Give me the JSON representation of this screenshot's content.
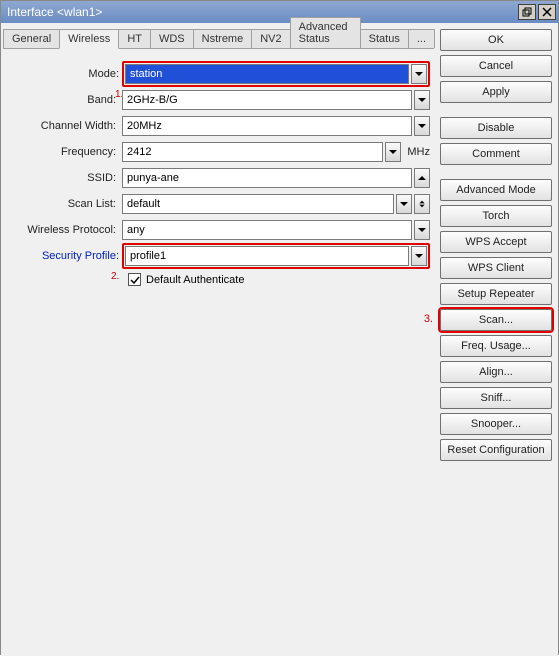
{
  "window": {
    "title": "Interface <wlan1>"
  },
  "tabs": {
    "general": "General",
    "wireless": "Wireless",
    "ht": "HT",
    "wds": "WDS",
    "nstreme": "Nstreme",
    "nv2": "NV2",
    "advanced_status": "Advanced Status",
    "status": "Status",
    "more": "..."
  },
  "form": {
    "mode_label": "Mode:",
    "mode_value": "station",
    "band_label": "Band:",
    "band_value": "2GHz-B/G",
    "chwidth_label": "Channel Width:",
    "chwidth_value": "20MHz",
    "freq_label": "Frequency:",
    "freq_value": "2412",
    "freq_unit": "MHz",
    "ssid_label": "SSID:",
    "ssid_value": "punya-ane",
    "scanlist_label": "Scan List:",
    "scanlist_value": "default",
    "wproto_label": "Wireless Protocol:",
    "wproto_value": "any",
    "secprof_label": "Security Profile:",
    "secprof_value": "profile1",
    "default_auth_label": "Default Authenticate"
  },
  "annotations": {
    "one": "1.",
    "two": "2.",
    "three": "3."
  },
  "buttons": {
    "ok": "OK",
    "cancel": "Cancel",
    "apply": "Apply",
    "disable": "Disable",
    "comment": "Comment",
    "advanced_mode": "Advanced Mode",
    "torch": "Torch",
    "wps_accept": "WPS Accept",
    "wps_client": "WPS Client",
    "setup_repeater": "Setup Repeater",
    "scan": "Scan...",
    "freq_usage": "Freq. Usage...",
    "align": "Align...",
    "sniff": "Sniff...",
    "snooper": "Snooper...",
    "reset_config": "Reset Configuration"
  }
}
